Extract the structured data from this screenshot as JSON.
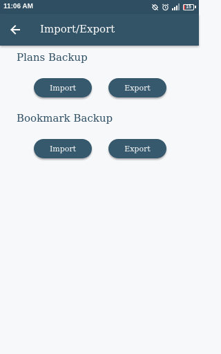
{
  "status_bar": {
    "time": "11:06 AM",
    "battery_level": "15",
    "battery_fraction": 0.15,
    "icons": [
      "sync-off-icon",
      "alarm-icon",
      "signal-icon",
      "battery-icon"
    ]
  },
  "app_bar": {
    "title": "Import/Export",
    "back_icon": "arrow-left-icon"
  },
  "sections": {
    "plans": {
      "title": "Plans Backup",
      "import_label": "Import",
      "export_label": "Export"
    },
    "bookmark": {
      "title": "Bookmark Backup",
      "import_label": "Import",
      "export_label": "Export"
    }
  },
  "colors": {
    "primary": "#335366",
    "button": "#37596d",
    "section_title": "#2f4e62",
    "background": "#f7f8fa",
    "battery_low": "#e35252"
  }
}
